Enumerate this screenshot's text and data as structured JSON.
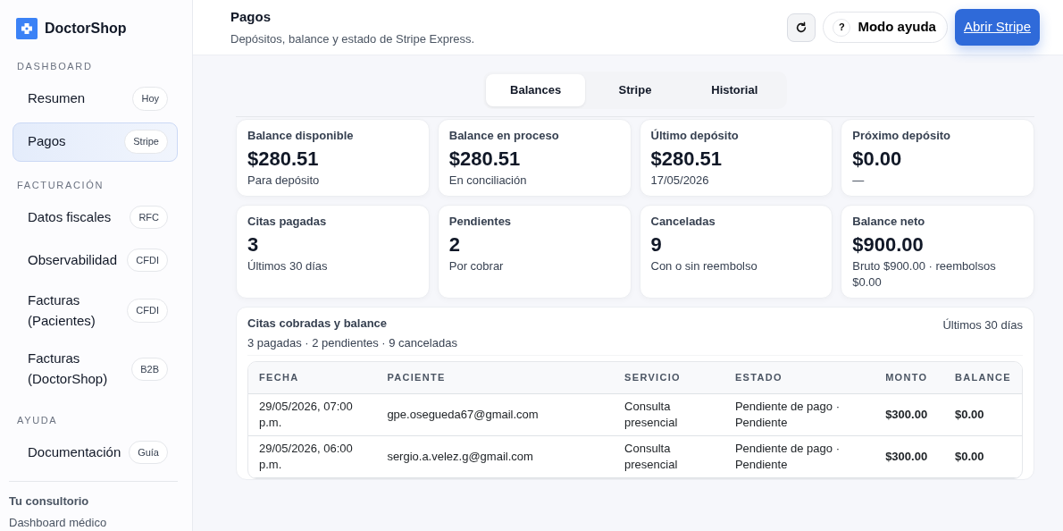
{
  "brand": {
    "name": "DoctorShop"
  },
  "sidebar": {
    "sections": [
      {
        "title": "DASHBOARD",
        "items": [
          {
            "label": "Resumen",
            "badge": "Hoy",
            "selected": false
          },
          {
            "label": "Pagos",
            "badge": "Stripe",
            "selected": true
          }
        ]
      },
      {
        "title": "FACTURACIÓN",
        "items": [
          {
            "label": "Datos fiscales",
            "badge": "RFC",
            "selected": false
          },
          {
            "label": "Observabilidad",
            "badge": "CFDI",
            "selected": false
          },
          {
            "label": "Facturas (Pacientes)",
            "badge": "CFDI",
            "selected": false
          },
          {
            "label": "Facturas (DoctorShop)",
            "badge": "B2B",
            "selected": false
          }
        ]
      },
      {
        "title": "AYUDA",
        "items": [
          {
            "label": "Documentación",
            "badge": "Guía",
            "selected": false
          }
        ]
      }
    ],
    "footer": {
      "title": "Tu consultorio",
      "subtitle": "Dashboard médico"
    }
  },
  "header": {
    "title": "Pagos",
    "subtitle": "Depósitos, balance y estado de Stripe Express.",
    "help_button": "Modo ayuda",
    "help_icon": "?",
    "primary_button": "Abrir Stripe"
  },
  "tabs": [
    {
      "label": "Balances",
      "selected": true
    },
    {
      "label": "Stripe",
      "selected": false
    },
    {
      "label": "Historial",
      "selected": false
    }
  ],
  "stats": [
    {
      "label": "Balance disponible",
      "value": "$280.51",
      "note": "Para depósito"
    },
    {
      "label": "Balance en proceso",
      "value": "$280.51",
      "note": "En conciliación"
    },
    {
      "label": "Último depósito",
      "value": "$280.51",
      "note": "17/05/2026"
    },
    {
      "label": "Próximo depósito",
      "value": "$0.00",
      "note": "—"
    },
    {
      "label": "Citas pagadas",
      "value": "3",
      "note": "Últimos 30 días"
    },
    {
      "label": "Pendientes",
      "value": "2",
      "note": "Por cobrar"
    },
    {
      "label": "Canceladas",
      "value": "9",
      "note": "Con o sin reembolso"
    },
    {
      "label": "Balance neto",
      "value": "$900.00",
      "note": "Bruto $900.00 · reembolsos $0.00"
    }
  ],
  "table": {
    "title": "Citas cobradas y balance",
    "summary": "3 pagadas · 2 pendientes · 9 canceladas",
    "period": "Últimos 30 días",
    "columns": [
      "FECHA",
      "PACIENTE",
      "SERVICIO",
      "ESTADO",
      "MONTO",
      "BALANCE"
    ],
    "rows": [
      [
        "29/05/2026, 07:00 p.m.",
        "gpe.osegueda67@gmail.com",
        "Consulta presencial",
        "Pendiente de pago · Pendiente",
        "$300.00",
        "$0.00"
      ],
      [
        "29/05/2026, 06:00 p.m.",
        "sergio.a.velez.g@gmail.com",
        "Consulta presencial",
        "Pendiente de pago · Pendiente",
        "$300.00",
        "$0.00"
      ]
    ]
  }
}
